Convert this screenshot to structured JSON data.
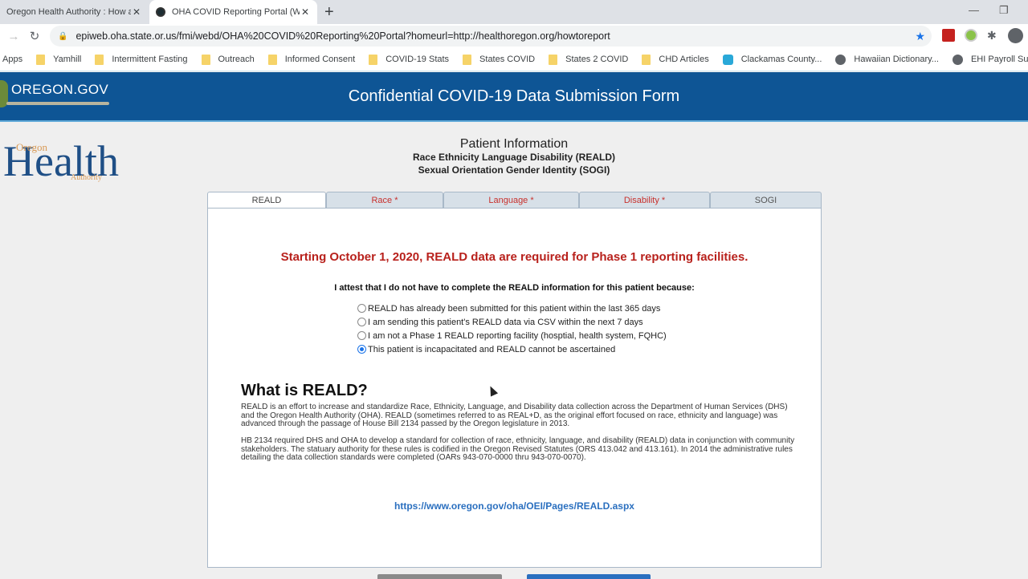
{
  "browser": {
    "tabs": [
      {
        "title": "Oregon Health Authority : How a",
        "active": false
      },
      {
        "title": "OHA COVID Reporting Portal (Wi",
        "active": true
      }
    ],
    "new_tab": "+",
    "url": "epiweb.oha.state.or.us/fmi/webd/OHA%20COVID%20Reporting%20Portal?homeurl=http://healthoregon.org/howtoreport",
    "bookmarks": [
      {
        "label": "Apps",
        "icon": "apps-icon"
      },
      {
        "label": "Yamhill",
        "icon": "folder-icon"
      },
      {
        "label": "Intermittent Fasting",
        "icon": "folder-icon"
      },
      {
        "label": "Outreach",
        "icon": "folder-icon"
      },
      {
        "label": "Informed Consent",
        "icon": "folder-icon"
      },
      {
        "label": "COVID-19 Stats",
        "icon": "folder-icon"
      },
      {
        "label": "States COVID",
        "icon": "folder-icon"
      },
      {
        "label": "States 2 COVID",
        "icon": "folder-icon"
      },
      {
        "label": "CHD Articles",
        "icon": "folder-icon"
      },
      {
        "label": "Clackamas County...",
        "icon": "site-icon"
      },
      {
        "label": "Hawaiian Dictionary...",
        "icon": "globe-icon"
      },
      {
        "label": "EHI Payroll Submiss...",
        "icon": "globe-icon"
      }
    ]
  },
  "banner": {
    "logo_text": "OREGON.GOV",
    "title": "Confidential COVID-19 Data Submission Form"
  },
  "oha_logo": {
    "small_top": "Oregon",
    "main": "Health",
    "small_bottom": "Authority"
  },
  "header": {
    "title": "Patient Information",
    "subtitle1": "Race Ethnicity Language Disability (REALD)",
    "subtitle2": "Sexual Orientation Gender Identity (SOGI)"
  },
  "form_tabs": [
    {
      "label": "REALD",
      "active": true
    },
    {
      "label": "Race *",
      "active": false
    },
    {
      "label": "Language *",
      "active": false
    },
    {
      "label": "Disability *",
      "active": false
    },
    {
      "label": "SOGI",
      "active": false
    }
  ],
  "panel": {
    "notice": "Starting October 1, 2020, REALD data are required for Phase 1 reporting facilities.",
    "attest": "I attest that I do not have to complete the REALD information for this patient because:",
    "options": [
      {
        "label": "REALD has already been submitted for this patient within the last 365 days",
        "checked": false
      },
      {
        "label": "I am sending this patient's REALD data via CSV within the next 7 days",
        "checked": false
      },
      {
        "label": "I am not a Phase 1 REALD reporting facility (hosptial, health system, FQHC)",
        "checked": false
      },
      {
        "label": "This patient is incapacitated and REALD cannot be ascertained",
        "checked": true
      }
    ],
    "what_title": "What is REALD?",
    "para1": "REALD is an effort to increase and standardize Race, Ethnicity, Language, and Disability data collection across the Department of Human Services (DHS) and the Oregon Health Authority (OHA). REALD (sometimes referred to as REAL+D, as the original effort focused on race, ethnicity and language) was advanced through the passage of House Bill 2134 passed by the Oregon legislature in 2013.",
    "para2": "HB 2134 required DHS and OHA to develop a standard for collection of race, ethnicity, language, and disability (REALD) data in conjunction with community stakeholders. The statuary authority for these rules is codified in the Oregon Revised Statutes (ORS 413.042 and 413.161). In 2014 the administrative rules detailing the data collection standards were completed (OARs 943-070-0000 thru 943-070-0070).",
    "link": "https://www.oregon.gov/oha/OEI/Pages/REALD.aspx"
  },
  "colors": {
    "banner": "#0e5595",
    "notice": "#b8211c",
    "link": "#2a6fbf",
    "required_tab": "#c8302c"
  }
}
